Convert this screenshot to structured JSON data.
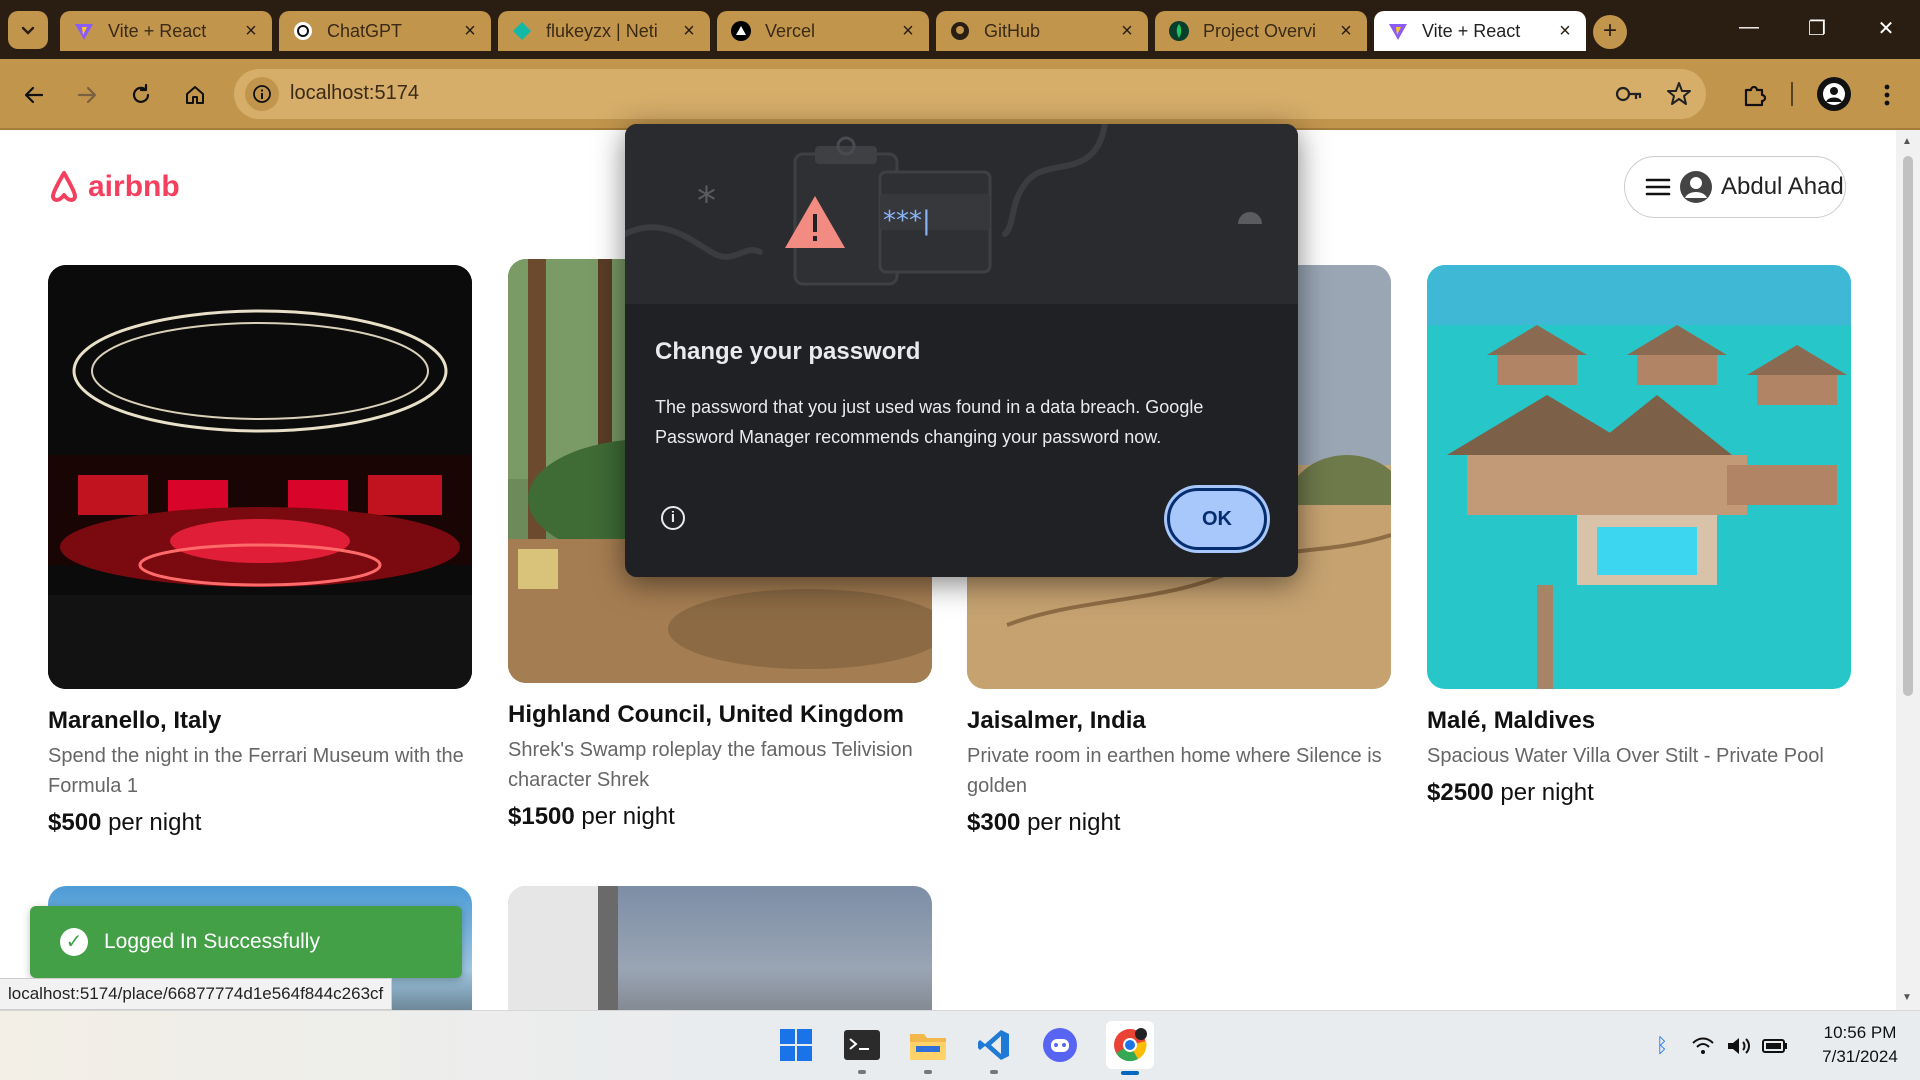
{
  "browser": {
    "tabs": [
      {
        "title": "Vite + React",
        "icon": "vite-icon",
        "active": false
      },
      {
        "title": "ChatGPT",
        "icon": "chatgpt-icon",
        "active": false
      },
      {
        "title": "flukeyzx | Neti",
        "icon": "netlify-icon",
        "active": false
      },
      {
        "title": "Vercel",
        "icon": "vercel-icon",
        "active": false
      },
      {
        "title": "GitHub",
        "icon": "github-icon",
        "active": false
      },
      {
        "title": "Project Overvi",
        "icon": "mongodb-icon",
        "active": false
      },
      {
        "title": "Vite + React",
        "icon": "vite-icon",
        "active": true
      }
    ],
    "address": "localhost:5174"
  },
  "site": {
    "logo_text": "airbnb",
    "user_name": "Abdul Ahad",
    "accent_color": "#f43f5e"
  },
  "listings": [
    {
      "location": "Maranello, Italy",
      "description": "Spend the night in the Ferrari Museum with the Formula 1",
      "price": "$500",
      "per": "per night"
    },
    {
      "location": "Highland Council, United Kingdom",
      "description": "Shrek's Swamp roleplay the famous Telivision character Shrek",
      "price": "$1500",
      "per": "per night"
    },
    {
      "location": "Jaisalmer, India",
      "description": "Private room in earthen home where Silence is golden",
      "price": "$300",
      "per": "per night"
    },
    {
      "location": "Malé, Maldives",
      "description": "Spacious Water Villa Over Stilt - Private Pool",
      "price": "$2500",
      "per": "per night"
    }
  ],
  "dialog": {
    "title": "Change your password",
    "body": "The password that you just used was found in a data breach. Google Password Manager recommends changing your password now.",
    "ok_label": "OK",
    "password_mask": "***|"
  },
  "toast": {
    "message": "Logged In Successfully",
    "color": "#43a047"
  },
  "status_url": "localhost:5174/place/66877774d1e564f844c263cf",
  "taskbar": {
    "apps": [
      "windows-start-icon",
      "terminal-icon",
      "file-explorer-icon",
      "vscode-icon",
      "discord-icon",
      "chrome-icon"
    ],
    "time": "10:56 PM",
    "date": "7/31/2024"
  }
}
